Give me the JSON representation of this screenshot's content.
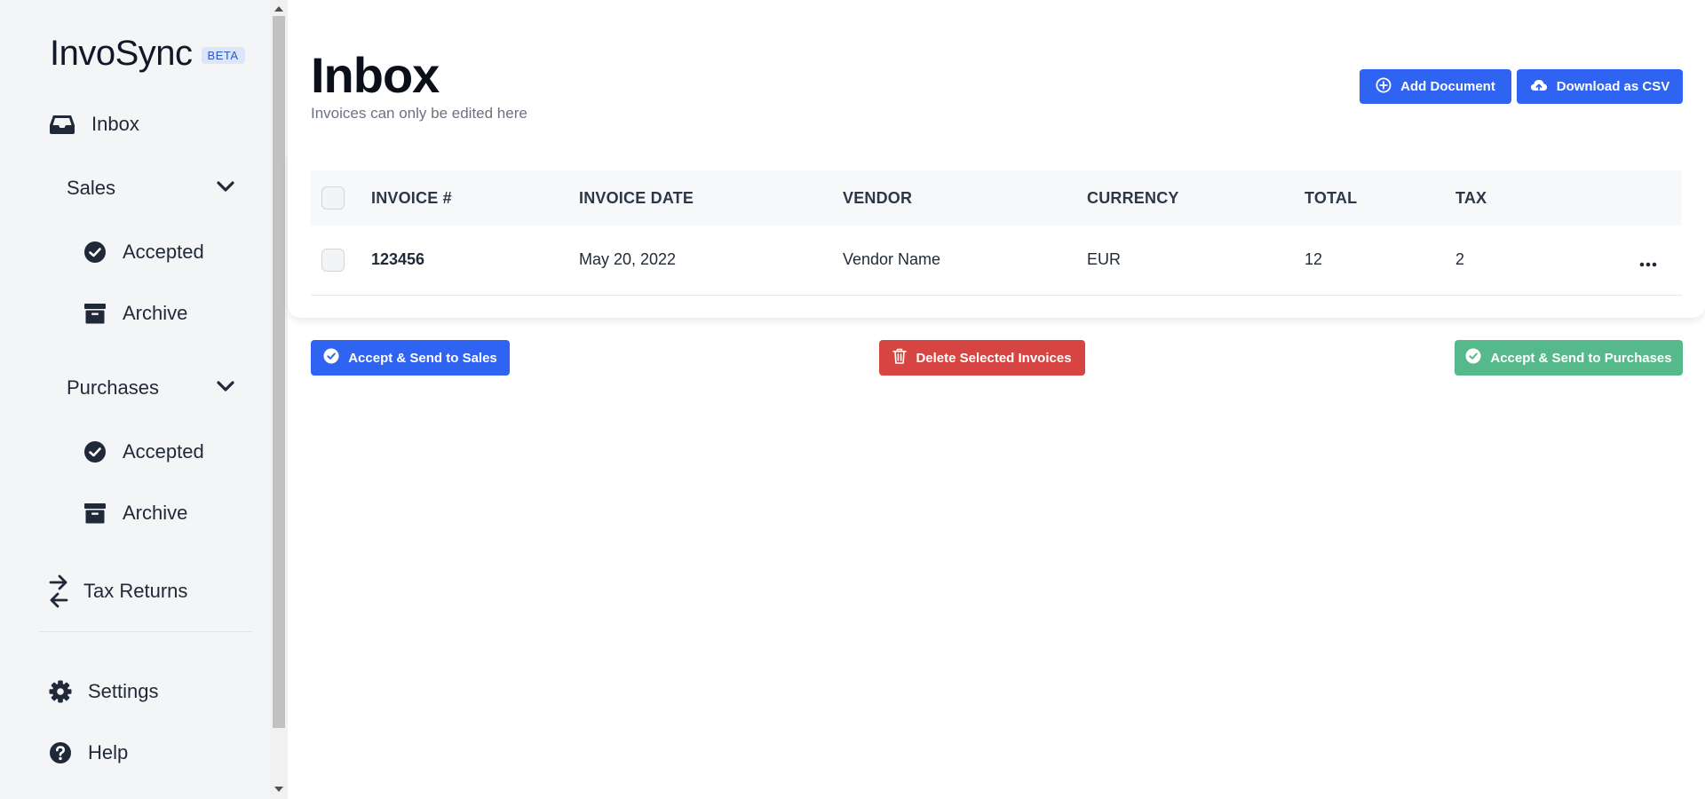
{
  "sidebar": {
    "logo": "InvoSync",
    "badge": "BETA",
    "inbox": "Inbox",
    "sales": {
      "label": "Sales",
      "accepted": "Accepted",
      "archive": "Archive"
    },
    "purchases": {
      "label": "Purchases",
      "accepted": "Accepted",
      "archive": "Archive"
    },
    "tax_returns": "Tax Returns",
    "settings": "Settings",
    "help": "Help"
  },
  "page": {
    "title": "Inbox",
    "subtitle": "Invoices can only be edited here"
  },
  "toolbar": {
    "add_document": "Add Document",
    "download_csv": "Download as CSV"
  },
  "table": {
    "columns": [
      "INVOICE #",
      "INVOICE DATE",
      "VENDOR",
      "CURRENCY",
      "TOTAL",
      "TAX"
    ],
    "rows": [
      {
        "invoice": "123456",
        "date": "May 20, 2022",
        "vendor": "Vendor Name",
        "currency": "EUR",
        "total": "12",
        "tax": "2"
      }
    ]
  },
  "actions": {
    "accept_sales": "Accept & Send to Sales",
    "delete_selected": "Delete Selected Invoices",
    "accept_purchases": "Accept & Send to Purchases"
  },
  "colors": {
    "primary": "#2f63f2",
    "danger": "#d64541",
    "success": "#55b98b",
    "sidebar_bg": "#f4f5f7"
  },
  "icons": [
    "inbox-icon",
    "chevron-down-icon",
    "check-circle-icon",
    "archive-box-icon",
    "arrows-exchange-icon",
    "gear-icon",
    "question-circle-icon",
    "plus-circle-icon",
    "cloud-upload-icon",
    "trash-icon",
    "ellipsis-icon"
  ]
}
